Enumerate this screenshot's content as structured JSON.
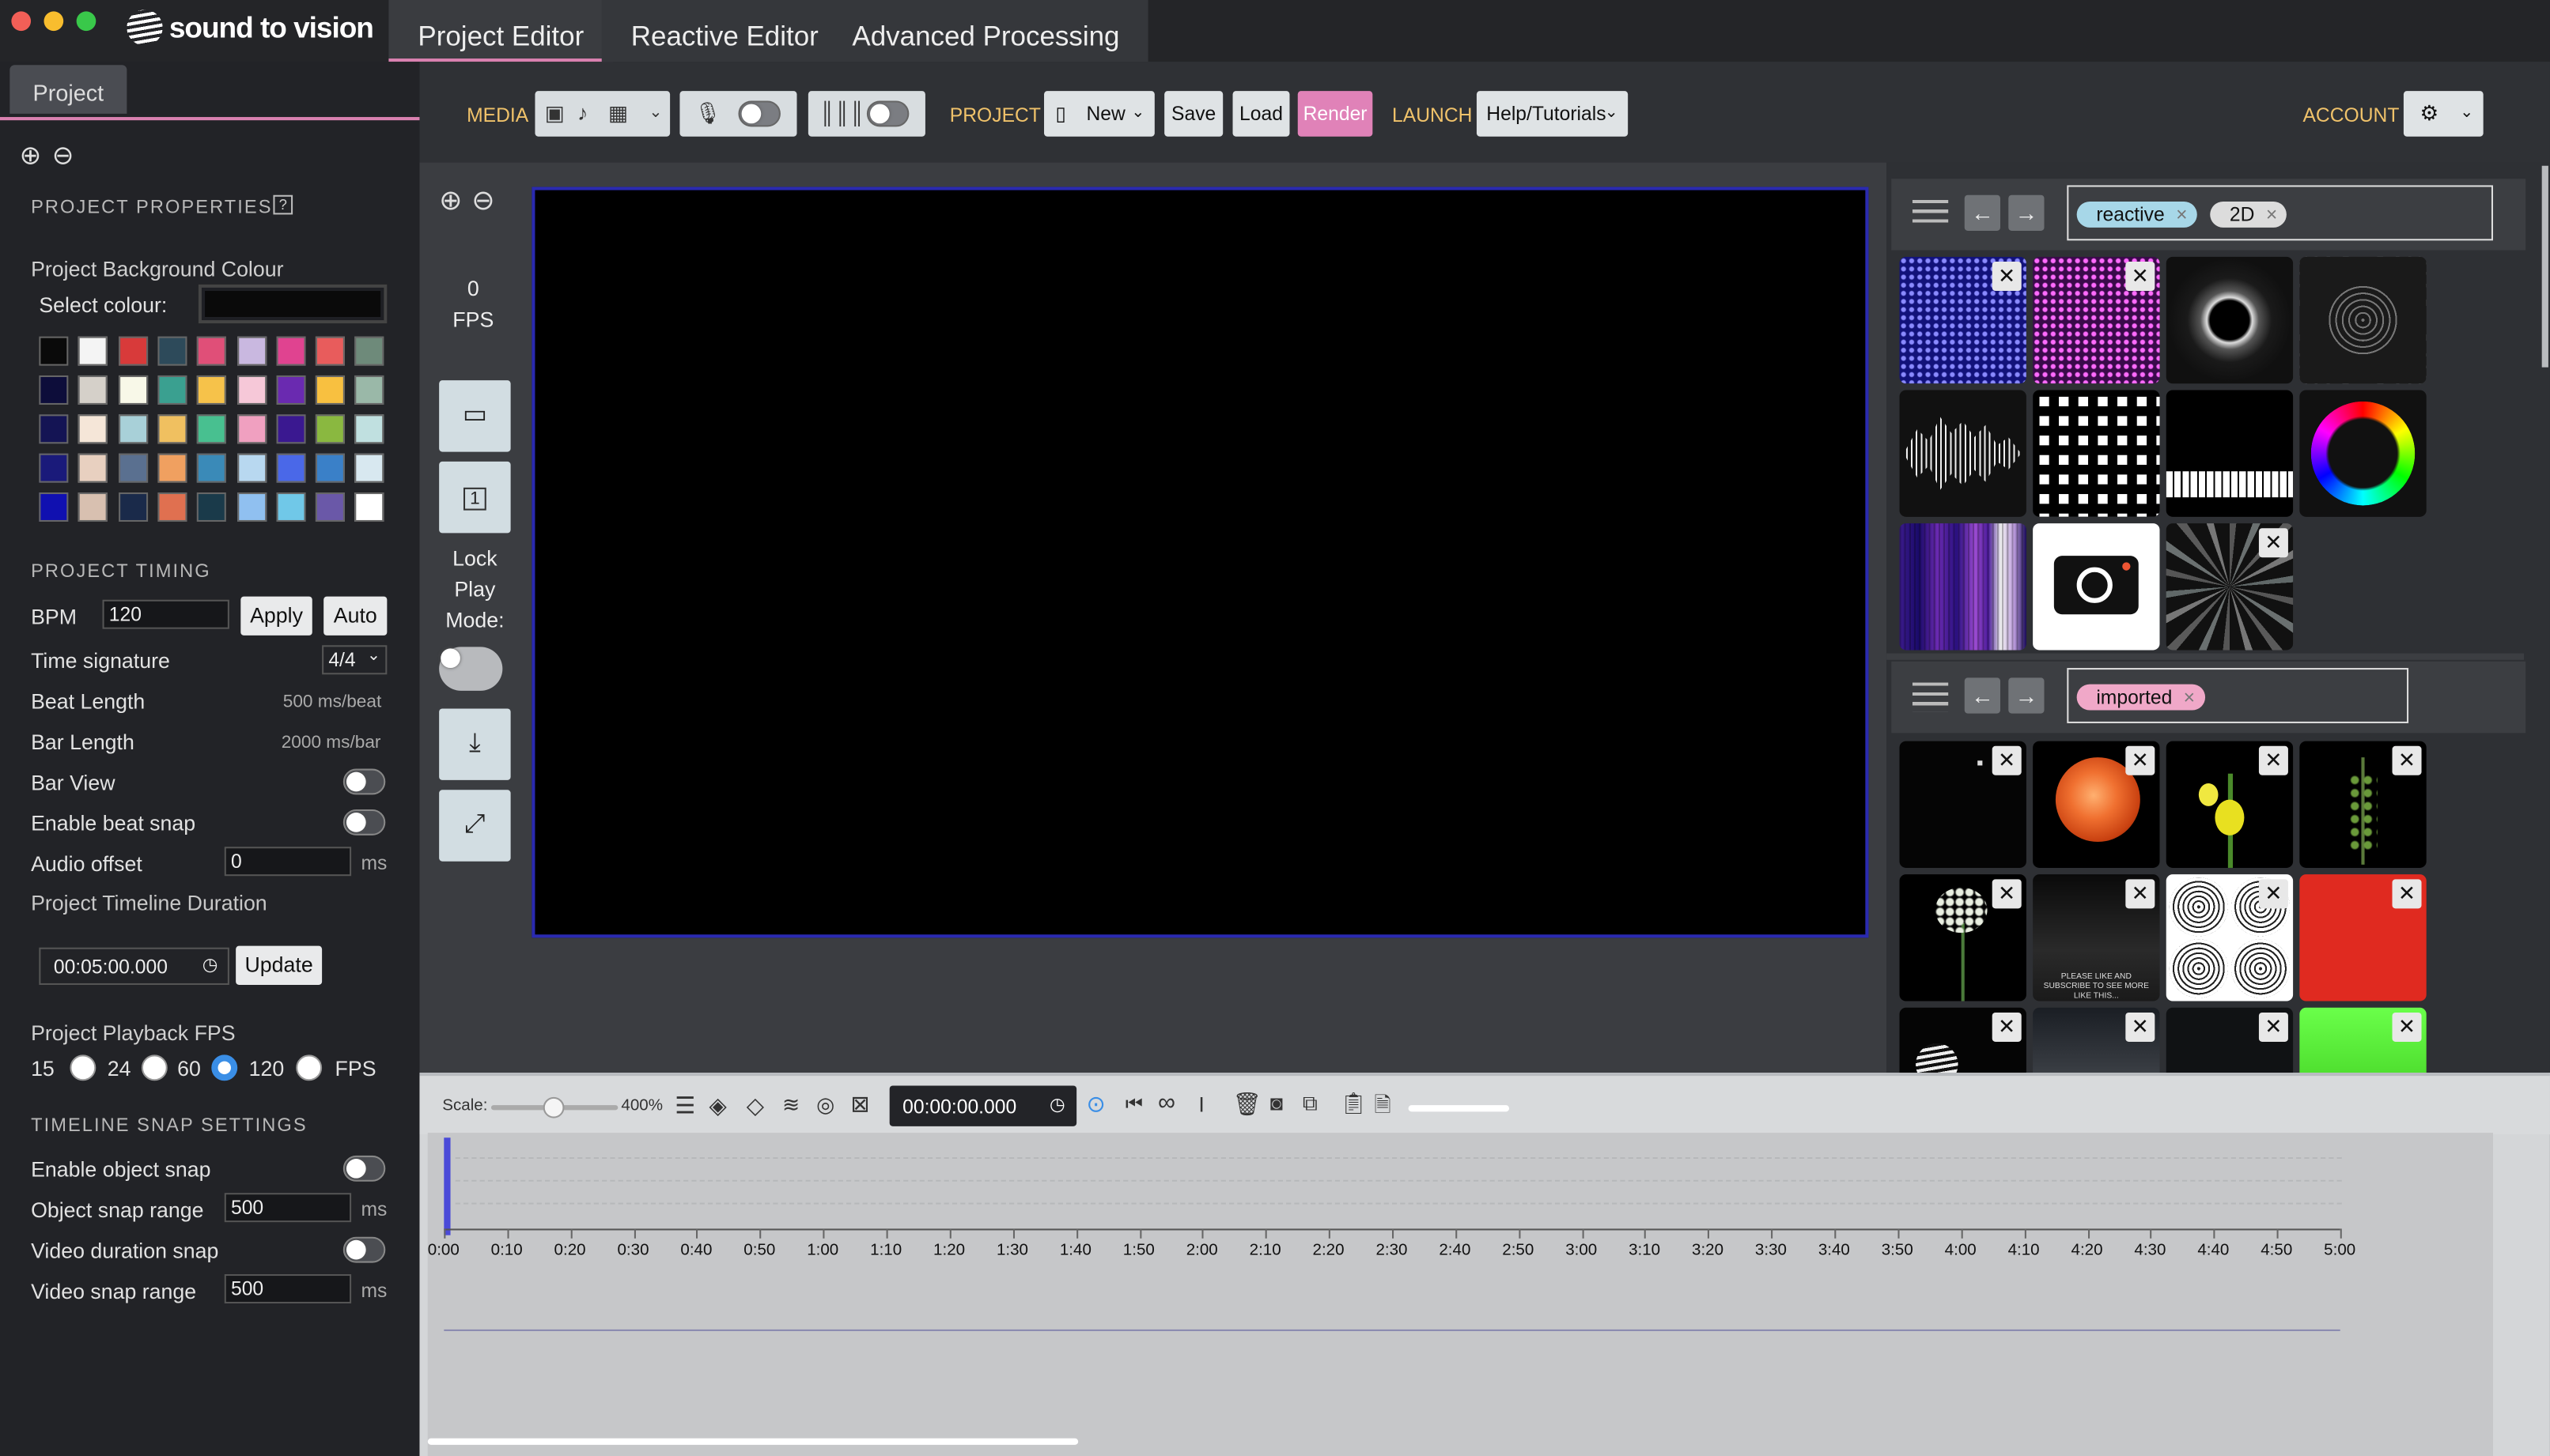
{
  "window": {
    "traffic_lights": [
      "#f25f57",
      "#f8bd2e",
      "#39c84a"
    ]
  },
  "app": {
    "logo_text": "sound to vision"
  },
  "main_tabs": [
    "Project Editor",
    "Reactive Editor",
    "Advanced Processing"
  ],
  "left_panel": {
    "tab": "Project",
    "properties_heading": "PROJECT PROPERTIES",
    "bg_colour_label": "Project Background Colour",
    "select_colour_label": "Select colour:",
    "swatches": [
      [
        "#0a0a0a",
        "#f4f4f4",
        "#d83a3a",
        "#2d4a5a",
        "#e04f78",
        "#c9b8e0",
        "#e04390",
        "#e85c5c",
        "#6e8a7a"
      ],
      [
        "#0d0d3a",
        "#d5d0c9",
        "#f8f8e8",
        "#3aa090",
        "#f6c24a",
        "#f6c8d8",
        "#6a2ab0",
        "#f8c040",
        "#9ab8a8"
      ],
      [
        "#141454",
        "#f5e6d8",
        "#a8d0d8",
        "#f0c060",
        "#48c090",
        "#f0a0c0",
        "#3a1890",
        "#8ab840",
        "#c0e0e0"
      ],
      [
        "#1a1a7a",
        "#e8d0c0",
        "#5a7090",
        "#f0a060",
        "#3a8ab8",
        "#b8d8f0",
        "#4a68e8",
        "#3a80c8",
        "#d8e8f0"
      ],
      [
        "#1010b0",
        "#d8c0b0",
        "#1a2a4a",
        "#e07050",
        "#1a3a4a",
        "#90c0f0",
        "#70c8e8",
        "#6a58a8",
        "#ffffff"
      ]
    ],
    "timing_heading": "PROJECT TIMING",
    "bpm_label": "BPM",
    "bpm_value": "120",
    "apply_label": "Apply",
    "auto_label": "Auto",
    "time_sig_label": "Time signature",
    "time_sig_value": "4/4",
    "beat_length_label": "Beat Length",
    "beat_length_value": "500 ms/beat",
    "bar_length_label": "Bar Length",
    "bar_length_value": "2000 ms/bar",
    "bar_view_label": "Bar View",
    "beat_snap_label": "Enable beat snap",
    "audio_offset_label": "Audio offset",
    "audio_offset_value": "0",
    "ms": "ms",
    "duration_label": "Project Timeline Duration",
    "duration_value": "00:05:00.000",
    "update_label": "Update",
    "fps_label": "Project Playback FPS",
    "fps_options": [
      "15",
      "24",
      "60",
      "120"
    ],
    "fps_selected": "120",
    "fps_suffix": "FPS",
    "snap_heading": "TIMELINE SNAP SETTINGS",
    "object_snap_label": "Enable object snap",
    "object_snap_range_label": "Object snap range",
    "object_snap_range_value": "500",
    "video_duration_snap_label": "Video duration snap",
    "video_snap_range_label": "Video snap range",
    "video_snap_range_value": "500"
  },
  "toolbar": {
    "media_label": "MEDIA",
    "project_label": "PROJECT",
    "new_label": "New",
    "save_label": "Save",
    "load_label": "Load",
    "render_label": "Render",
    "launch_label": "LAUNCH",
    "help_label": "Help/Tutorials",
    "account_label": "ACCOUNT"
  },
  "viewer": {
    "fps_value": "0",
    "fps_unit": "FPS",
    "lock_label": "Lock Play Mode:"
  },
  "library_top": {
    "tags": [
      "reactive",
      "2D"
    ]
  },
  "library_bottom": {
    "tags": [
      "imported"
    ],
    "thumb_caption": "PLEASE LIKE AND SUBSCRIBE TO SEE MORE LIKE THIS..."
  },
  "timeline": {
    "scale_label": "Scale:",
    "scale_value": "400%",
    "time_value": "00:00:00.000",
    "ticks": [
      "0:00",
      "0:10",
      "0:20",
      "0:30",
      "0:40",
      "0:50",
      "1:00",
      "1:10",
      "1:20",
      "1:30",
      "1:40",
      "1:50",
      "2:00",
      "2:10",
      "2:20",
      "2:30",
      "2:40",
      "2:50",
      "3:00",
      "3:10",
      "3:20",
      "3:30",
      "3:40",
      "3:50",
      "4:00",
      "4:10",
      "4:20",
      "4:30",
      "4:40",
      "4:50",
      "5:00"
    ]
  }
}
